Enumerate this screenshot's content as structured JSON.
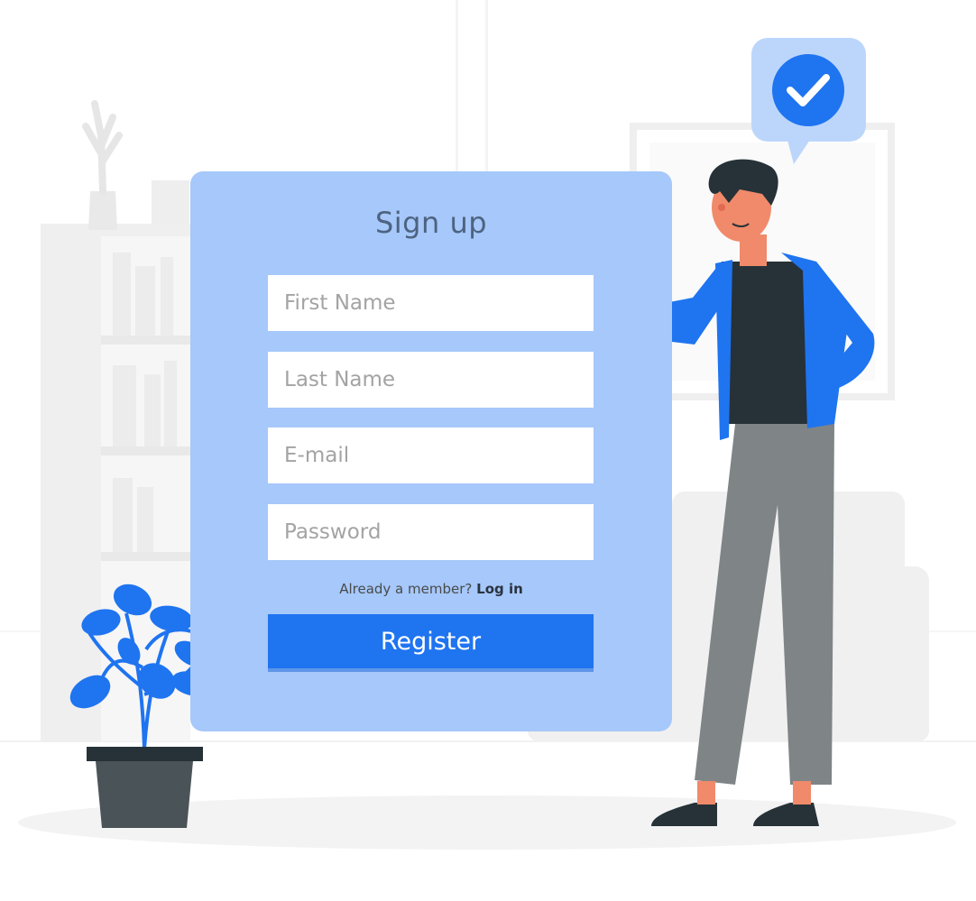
{
  "form": {
    "title": "Sign up",
    "fields": [
      {
        "placeholder": "First Name"
      },
      {
        "placeholder": "Last Name"
      },
      {
        "placeholder": "E-mail"
      },
      {
        "placeholder": "Password"
      }
    ],
    "member_prompt": "Already a member?",
    "login_link": "Log in",
    "register_label": "Register"
  },
  "colors": {
    "card": "#a6c8fa",
    "accent": "#1f74f0",
    "title": "#4d6380",
    "bubble": "#bcd6fb"
  },
  "icons": [
    "check-icon",
    "plant-icon",
    "person-illustration",
    "vase-icon"
  ]
}
